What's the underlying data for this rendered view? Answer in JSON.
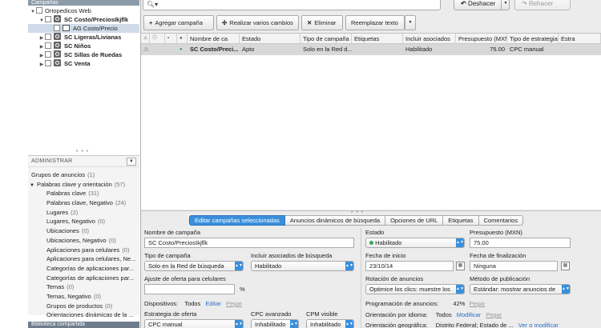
{
  "sidebar": {
    "header": "Campañas",
    "tree": [
      {
        "label": "Ortopedicos Web",
        "bold": false,
        "level": 0,
        "expanded": true,
        "type": "account"
      },
      {
        "label": "SC Costo/PreciosIkjflk",
        "bold": true,
        "level": 1,
        "expanded": true,
        "type": "campaign"
      },
      {
        "label": "AG Costo/Precio",
        "bold": false,
        "level": 2,
        "expanded": null,
        "type": "adgroup",
        "selected": true
      },
      {
        "label": "SC Ligeras/Livianas",
        "bold": true,
        "level": 1,
        "expanded": false,
        "type": "campaign"
      },
      {
        "label": "SC Niños",
        "bold": true,
        "level": 1,
        "expanded": false,
        "type": "campaign"
      },
      {
        "label": "SC Sillas de Ruedas",
        "bold": true,
        "level": 1,
        "expanded": false,
        "type": "campaign"
      },
      {
        "label": "SC Venta",
        "bold": true,
        "level": 1,
        "expanded": false,
        "type": "campaign"
      }
    ],
    "admin": {
      "header": "ADMINISTRAR",
      "items": [
        {
          "label": "Grupos de anuncios",
          "count": "(1)",
          "indent": 0,
          "tri": ""
        },
        {
          "label": "Palabras clave y orientación",
          "count": "(57)",
          "indent": 0,
          "tri": "▼"
        },
        {
          "label": "Palabras clave",
          "count": "(31)",
          "indent": 1,
          "tri": ""
        },
        {
          "label": "Palabras clave, Negativo",
          "count": "(24)",
          "indent": 1,
          "tri": ""
        },
        {
          "label": "Lugares",
          "count": "(2)",
          "indent": 1,
          "tri": ""
        },
        {
          "label": "Lugares, Negativo",
          "count": "(0)",
          "indent": 1,
          "tri": ""
        },
        {
          "label": "Ubicaciones",
          "count": "(0)",
          "indent": 1,
          "tri": ""
        },
        {
          "label": "Ubicaciones, Negativo",
          "count": "(0)",
          "indent": 1,
          "tri": ""
        },
        {
          "label": "Aplicaciones para celulares",
          "count": "(0)",
          "indent": 1,
          "tri": ""
        },
        {
          "label": "Aplicaciones para celulares, Ne...",
          "count": "",
          "indent": 1,
          "tri": ""
        },
        {
          "label": "Categorías de aplicaciones par...",
          "count": "",
          "indent": 1,
          "tri": ""
        },
        {
          "label": "Categorías de aplicaciones par...",
          "count": "",
          "indent": 1,
          "tri": ""
        },
        {
          "label": "Temas",
          "count": "(0)",
          "indent": 1,
          "tri": ""
        },
        {
          "label": "Temas, Negativo",
          "count": "(0)",
          "indent": 1,
          "tri": ""
        },
        {
          "label": "Grupos de productos",
          "count": "(0)",
          "indent": 1,
          "tri": ""
        },
        {
          "label": "Orientaciones dinámicas de la ...",
          "count": "",
          "indent": 1,
          "tri": ""
        }
      ]
    },
    "library": "Biblioteca compartida"
  },
  "topbar": {
    "search_value": "",
    "undo_label": "Deshacer",
    "redo_label": "Rehacer"
  },
  "toolbar": {
    "add": "Agregar campaña",
    "bulk": "Realizar varios cambios",
    "delete": "Eliminar",
    "replace": "Reemplazar texto"
  },
  "grid": {
    "headers": [
      "",
      "",
      "",
      "",
      "Nombre de ca",
      "Estado",
      "Tipo de campaña",
      "Etiquetas",
      "Incluir asociados",
      "Presupuesto (MXN)",
      "Tipo de estrategia",
      "Estra"
    ],
    "rows": [
      {
        "warn": "⚠",
        "status_dot": "●",
        "name": "SC Costo/Preci...",
        "estado": "Apto",
        "tipo": "Solo en la Red d...",
        "etiquetas": "",
        "asociados": "Habilitado",
        "presupuesto": "75.00",
        "estrategia": "CPC manual",
        "estra": ""
      }
    ]
  },
  "edit": {
    "tabs": [
      "Editar campañas seleccionadas",
      "Anuncios dinámicos de búsqueda",
      "Opciones de URL",
      "Etiquetas",
      "Comentarios"
    ],
    "active_tab": 0,
    "left": {
      "nombre_label": "Nombre de campaña",
      "nombre_value": "SC Costo/PreciosIkjflk",
      "tipo_label": "Tipo de campaña",
      "tipo_value": "Solo en la Red de búsqueda",
      "asociados_label": "Incluir asociados de búsqueda",
      "asociados_value": "Habilitado",
      "ajuste_label": "Ajuste de oferta para celulares",
      "ajuste_value": "",
      "ajuste_unit": "%",
      "disp_label": "Dispositivos:",
      "disp_value": "Todos",
      "disp_edit": "Editar",
      "disp_paste": "Pegar",
      "estrategia_label": "Estrategia de oferta",
      "estrategia_value": "CPC manual",
      "cpc_label": "CPC avanzado",
      "cpc_value": "Inhabilitado",
      "cpm_label": "CPM visible",
      "cpm_value": "Inhabilitado"
    },
    "right": {
      "estado_label": "Estado",
      "estado_value": "Habilitado",
      "presupuesto_label": "Presupuesto (MXN)",
      "presupuesto_value": "75.00",
      "inicio_label": "Fecha de inicio",
      "inicio_value": "23/10/14",
      "fin_label": "Fecha de finalización",
      "fin_value": "Ninguna",
      "rotacion_label": "Rotación de anuncios",
      "rotacion_value": "Optimice los clics: muestre los",
      "metodo_label": "Método de publicación",
      "metodo_value": "Estándar: mostrar anuncios de",
      "prog_label": "Programación de anuncios:",
      "prog_value": "42%",
      "prog_paste": "Pegar",
      "idioma_label": "Orientación por idioma:",
      "idioma_value": "Todos",
      "idioma_edit": "Modificar",
      "idioma_paste": "Pegar",
      "geo_label": "Orientación geográfica:",
      "geo_value": "Distrito Federal; Estado de ...",
      "geo_edit": "Ver o modificar"
    }
  },
  "colors": {
    "accent": "#3a8fdc",
    "status_green": "#2fa84f",
    "selected_row": "#d8d8d8"
  }
}
